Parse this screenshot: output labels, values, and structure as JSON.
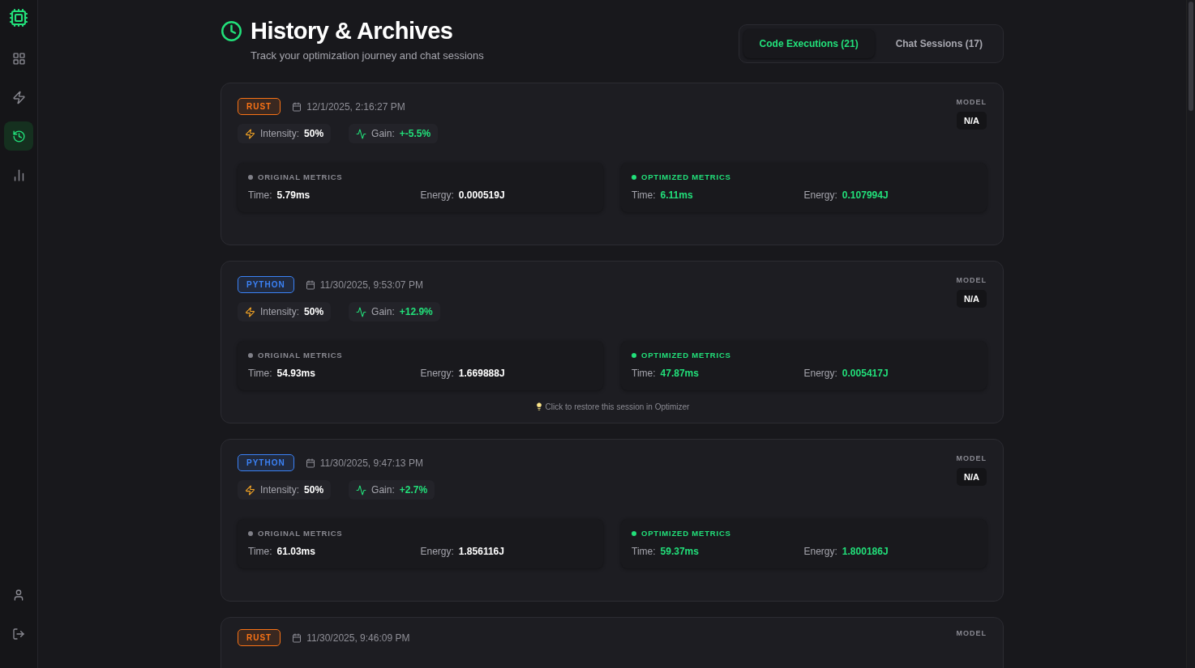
{
  "sidebar": {
    "nav": [
      {
        "selected": false
      },
      {
        "selected": false
      },
      {
        "selected": true
      },
      {
        "selected": false
      }
    ]
  },
  "header": {
    "title": "History & Archives",
    "subtitle": "Track your optimization journey and chat sessions"
  },
  "tabs": [
    {
      "label": "Code Executions (21)",
      "selected": true
    },
    {
      "label": "Chat Sessions (17)",
      "selected": false
    }
  ],
  "cards": [
    {
      "language": "RUST",
      "color": "#f97316",
      "date": "12/1/2025, 2:16:27 PM",
      "intensity_label": "Intensity:",
      "intensity": "50%",
      "gain_label": "Gain:",
      "gain": "+-5.5%",
      "model_label": "MODEL",
      "model": "N/A",
      "original": {
        "title": "ORIGINAL METRICS",
        "time_label": "Time:",
        "time": "5.79ms",
        "energy_label": "Energy:",
        "energy": "0.000519J"
      },
      "optimized": {
        "title": "OPTIMIZED METRICS",
        "time_label": "Time:",
        "time": "6.11ms",
        "energy_label": "Energy:",
        "energy": "0.107994J"
      }
    },
    {
      "language": "PYTHON",
      "color": "#3b82f6",
      "date": "11/30/2025, 9:53:07 PM",
      "intensity_label": "Intensity:",
      "intensity": "50%",
      "gain_label": "Gain:",
      "gain": "+12.9%",
      "model_label": "MODEL",
      "model": "N/A",
      "original": {
        "title": "ORIGINAL METRICS",
        "time_label": "Time:",
        "time": "54.93ms",
        "energy_label": "Energy:",
        "energy": "1.669888J"
      },
      "optimized": {
        "title": "OPTIMIZED METRICS",
        "time_label": "Time:",
        "time": "47.87ms",
        "energy_label": "Energy:",
        "energy": "0.005417J"
      },
      "hint": "Click to restore this session in Optimizer"
    },
    {
      "language": "PYTHON",
      "color": "#3b82f6",
      "date": "11/30/2025, 9:47:13 PM",
      "intensity_label": "Intensity:",
      "intensity": "50%",
      "gain_label": "Gain:",
      "gain": "+2.7%",
      "model_label": "MODEL",
      "model": "N/A",
      "original": {
        "title": "ORIGINAL METRICS",
        "time_label": "Time:",
        "time": "61.03ms",
        "energy_label": "Energy:",
        "energy": "1.856116J"
      },
      "optimized": {
        "title": "OPTIMIZED METRICS",
        "time_label": "Time:",
        "time": "59.37ms",
        "energy_label": "Energy:",
        "energy": "1.800186J"
      }
    },
    {
      "language": "RUST",
      "color": "#f97316",
      "date": "11/30/2025, 9:46:09 PM",
      "model_label": "MODEL"
    }
  ]
}
